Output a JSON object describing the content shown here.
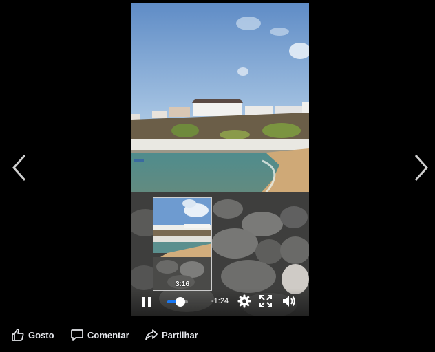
{
  "viewer": {
    "prev_icon": "chevron-left-icon",
    "next_icon": "chevron-right-icon"
  },
  "video": {
    "preview_time": "3:16",
    "time_remaining": "-1:24",
    "progress": 0.62,
    "state": "playing",
    "accent_color": "#1877f2",
    "icons": [
      "pause-icon",
      "gear-icon",
      "fullscreen-icon",
      "volume-icon"
    ]
  },
  "actions": {
    "like_label": "Gosto",
    "comment_label": "Comentar",
    "share_label": "Partilhar",
    "icons": [
      "thumbs-up-icon",
      "comment-bubble-icon",
      "share-arrow-icon"
    ]
  }
}
